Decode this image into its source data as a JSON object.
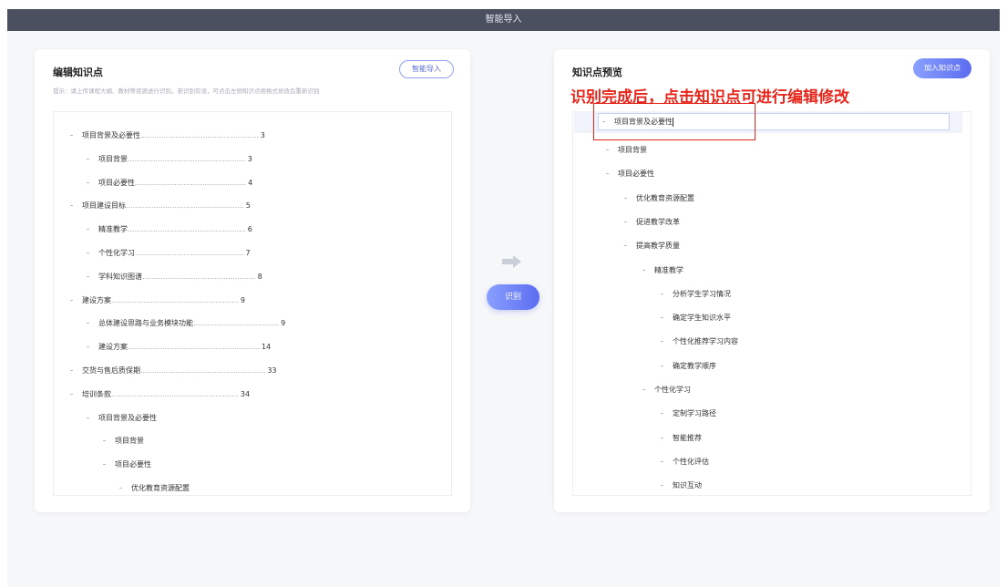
{
  "header": {
    "title": "智能导入"
  },
  "left": {
    "title": "编辑知识点",
    "hint": "提示：请上传课程大纲、教材等资源进行识别，若识别有误，可点击左侧知识点按格式修改后重新识别",
    "import_button": "智能导入",
    "items": [
      {
        "label": "项目背景及必要性",
        "dots": "...................................................",
        "page": "3"
      },
      {
        "label": "项目背景",
        "dots": "...................................................",
        "page": "3"
      },
      {
        "label": "项目必要性",
        "dots": "................................................",
        "page": "4"
      },
      {
        "label": "项目建设目标",
        "dots": "...................................................",
        "page": "5"
      },
      {
        "label": "精准教学",
        "dots": "...................................................",
        "page": "6"
      },
      {
        "label": "个性化学习",
        "dots": "...............................................",
        "page": "7"
      },
      {
        "label": "学科知识图谱",
        "dots": ".................................................",
        "page": "8"
      },
      {
        "label": "建设方案",
        "dots": ".......................................................",
        "page": "9"
      },
      {
        "label": "总体建设思路与业务模块功能",
        "dots": ".....................................",
        "page": "9"
      },
      {
        "label": "建设方案",
        "dots": ".........................................................",
        "page": "14"
      },
      {
        "label": "交货与售后质保期",
        "dots": "......................................................",
        "page": "33"
      },
      {
        "label": "培训条款",
        "dots": ".......................................................",
        "page": "34"
      },
      {
        "label": "项目背景及必要性",
        "dots": "",
        "page": ""
      },
      {
        "label": "项目背景",
        "dots": "",
        "page": ""
      },
      {
        "label": "项目必要性",
        "dots": "",
        "page": ""
      },
      {
        "label": "优化教育资源配置",
        "dots": "",
        "page": ""
      }
    ]
  },
  "middle": {
    "recognize_button": "识别"
  },
  "right": {
    "title": "知识点预览",
    "add_button": "加入知识点",
    "annotation": "识别完成后，点击知识点可进行编辑修改",
    "editing_value": "项目背景及必要性",
    "items": [
      {
        "label": "项目背景"
      },
      {
        "label": "项目必要性"
      },
      {
        "label": "优化教育资源配置"
      },
      {
        "label": "促进教学改革"
      },
      {
        "label": "提高教学质量"
      },
      {
        "label": "精准教学"
      },
      {
        "label": "分析学生学习情况"
      },
      {
        "label": "确定学生知识水平"
      },
      {
        "label": "个性化推荐学习内容"
      },
      {
        "label": "确定教学顺序"
      },
      {
        "label": "个性化学习"
      },
      {
        "label": "定制学习路径"
      },
      {
        "label": "智能推荐"
      },
      {
        "label": "个性化评估"
      },
      {
        "label": "知识互动"
      }
    ]
  }
}
